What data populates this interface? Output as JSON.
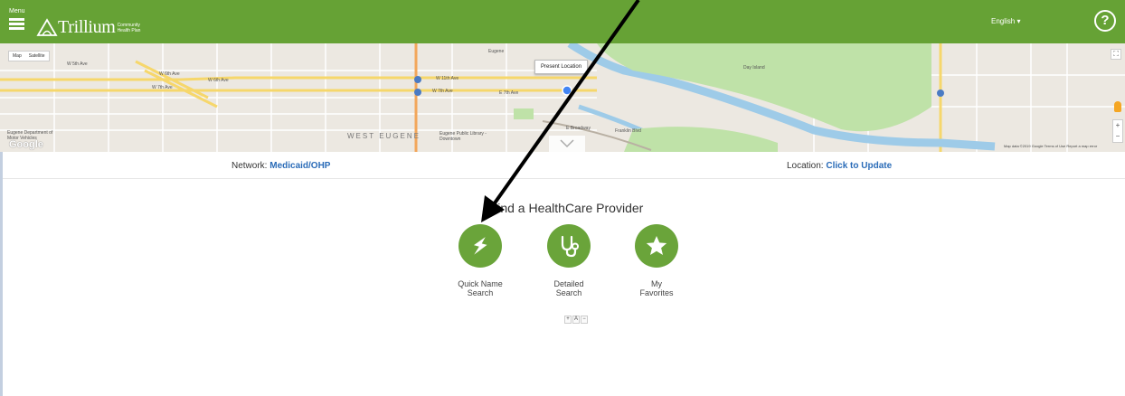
{
  "header": {
    "menu_label": "Menu",
    "logo_word": "Trillium",
    "logo_sub": "Community Health Plan",
    "language": "English ▾",
    "help": "?"
  },
  "map": {
    "type_options": [
      "Map",
      "Satellite"
    ],
    "present_location": "Present Location",
    "labels": {
      "w6th_ave_a": "W 6th Ave",
      "w6th_ave_b": "W 6th Ave",
      "w7th_ave": "W 7th Ave",
      "w7th_ave_b": "W 7th Ave",
      "e7th_ave": "E 7th Ave",
      "e_broadway": "E Broadway",
      "west_eugene": "WEST EUGENE",
      "library": "Eugene Public Library - Downtown",
      "dmv": "Eugene Department of Motor Vehicles",
      "day_island": "Day Island",
      "w5th_ave": "W 5th Ave",
      "eugene_station": "Eugene",
      "w11th": "W 11th Ave",
      "franklin": "Franklin Blvd"
    },
    "google": "Google",
    "footer": "Map data ©2019 Google   Terms of Use   Report a map error",
    "zoom_in": "+",
    "zoom_out": "−"
  },
  "info": {
    "network_label": "Network:",
    "network_value": "Medicaid/OHP",
    "location_label": "Location:",
    "location_value": "Click to Update"
  },
  "main": {
    "title": "Find a HealthCare Provider",
    "actions": [
      {
        "label_line1": "Quick Name",
        "label_line2": "Search",
        "icon": "lightning-icon"
      },
      {
        "label_line1": "Detailed",
        "label_line2": "Search",
        "icon": "stethoscope-icon"
      },
      {
        "label_line1": "My",
        "label_line2": "Favorites",
        "icon": "star-icon"
      }
    ],
    "font_controls": [
      "+",
      "A",
      "−"
    ]
  },
  "colors": {
    "brand_green": "#66a235",
    "action_green": "#6aa43a",
    "link_blue": "#2b6cb8"
  }
}
